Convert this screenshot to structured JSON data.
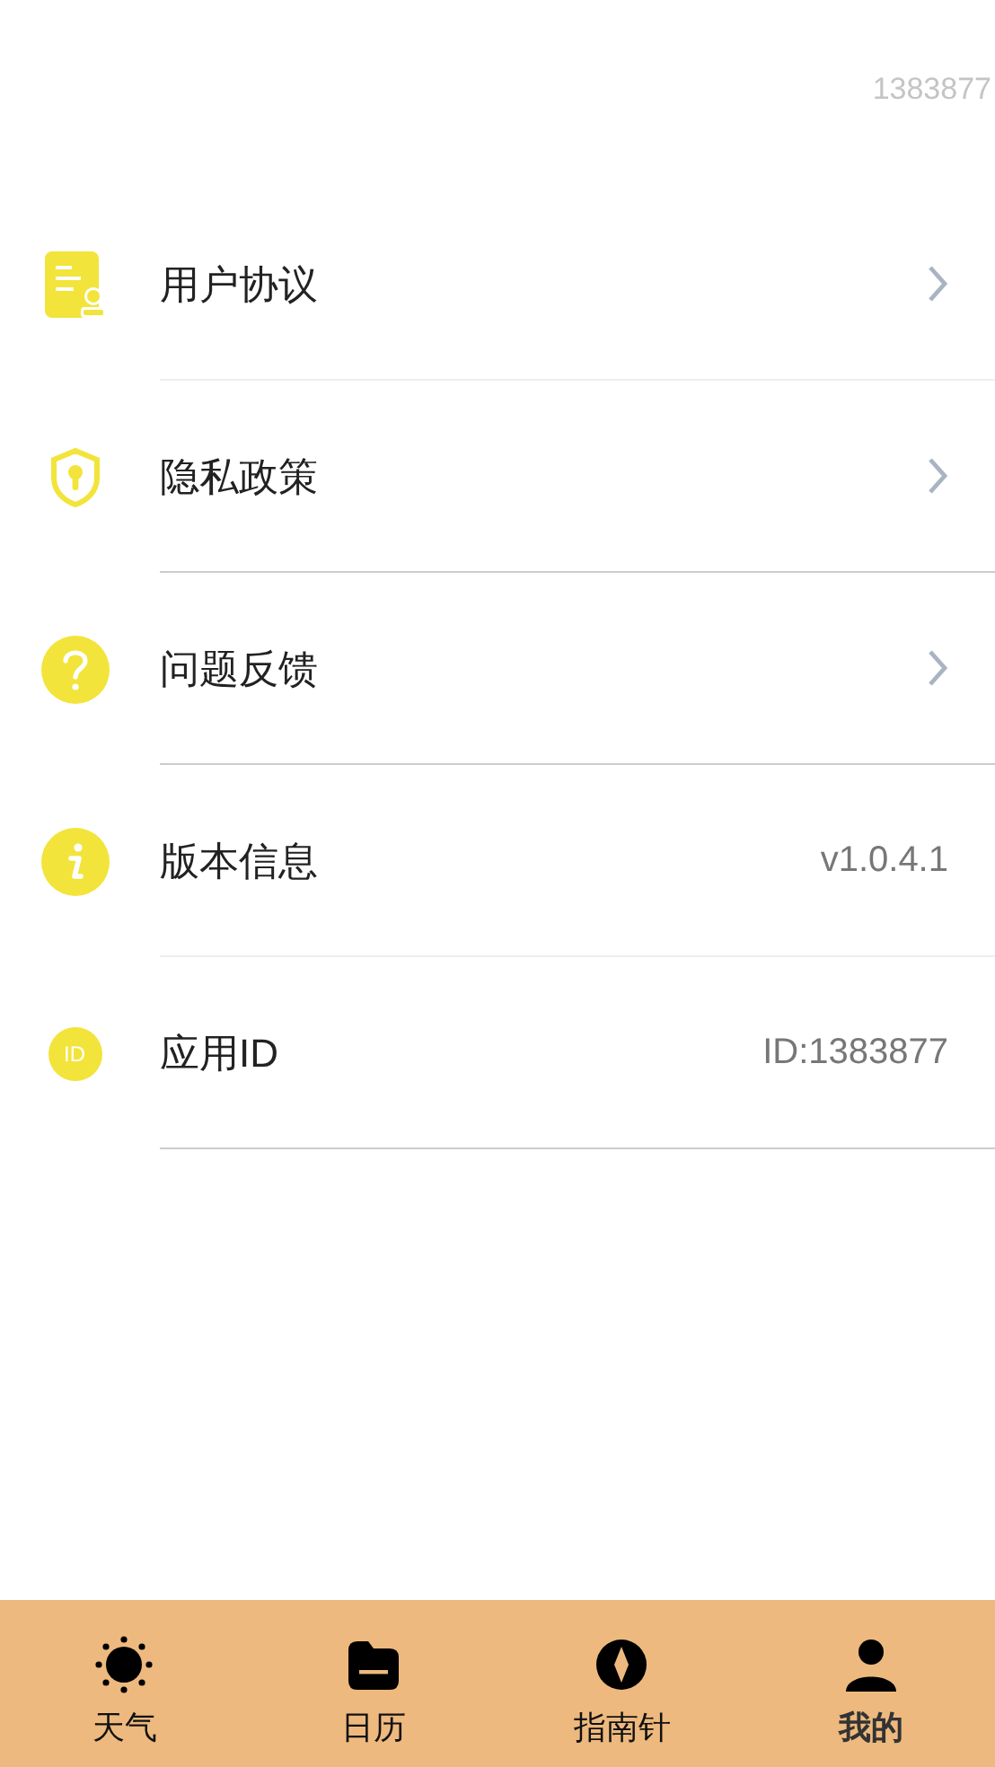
{
  "header": {
    "user_number": "1383877"
  },
  "menu_items": [
    {
      "label": "用户协议",
      "kind": "link"
    },
    {
      "label": "隐私政策",
      "kind": "link"
    },
    {
      "label": "问题反馈",
      "kind": "link"
    },
    {
      "label": "版本信息",
      "kind": "value",
      "value": "v1.0.4.1"
    },
    {
      "label": "应用ID",
      "kind": "value",
      "value": "ID:1383877",
      "icon_text": "ID"
    }
  ],
  "tab_bar": [
    {
      "label": "天气",
      "selected": false
    },
    {
      "label": "日历",
      "selected": false
    },
    {
      "label": "指南针",
      "selected": false
    },
    {
      "label": "我的",
      "selected": true
    }
  ]
}
